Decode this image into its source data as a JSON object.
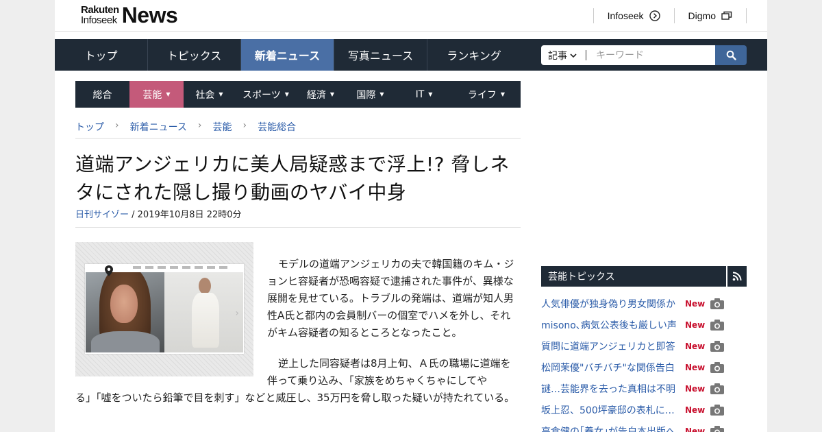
{
  "header": {
    "logo_brand": "Rakuten",
    "logo_sub": "Infoseek",
    "logo_product": "News",
    "links": [
      {
        "label": "Infoseek",
        "icon": "arrow-circle-icon"
      },
      {
        "label": "Digmo",
        "icon": "windows-icon"
      }
    ]
  },
  "main_nav": {
    "items": [
      {
        "label": "トップ",
        "active": false
      },
      {
        "label": "トピックス",
        "active": false
      },
      {
        "label": "新着ニュース",
        "active": true
      },
      {
        "label": "写真ニュース",
        "active": false
      },
      {
        "label": "ランキング",
        "active": false
      }
    ],
    "search": {
      "category": "記事",
      "placeholder": "キーワード"
    }
  },
  "category_nav": {
    "items": [
      {
        "label": "総合",
        "has_caret": false,
        "active": false
      },
      {
        "label": "芸能",
        "has_caret": true,
        "active": true
      },
      {
        "label": "社会",
        "has_caret": true,
        "active": false
      },
      {
        "label": "スポーツ",
        "has_caret": true,
        "active": false
      },
      {
        "label": "経済",
        "has_caret": true,
        "active": false
      },
      {
        "label": "国際",
        "has_caret": true,
        "active": false
      },
      {
        "label": "IT",
        "has_caret": true,
        "active": false
      },
      {
        "label": "ライフ",
        "has_caret": true,
        "active": false
      }
    ],
    "caret": "▼"
  },
  "breadcrumb": [
    "トップ",
    "新着ニュース",
    "芸能",
    "芸能総合"
  ],
  "article": {
    "title": "道端アンジェリカに美人局疑惑まで浮上!? 脅しネタにされた隠し撮り動画のヤバイ中身",
    "source": "日刊サイゾー",
    "date": " / 2019年10月8日 22時0分",
    "paragraph1": "モデルの道端アンジェリカの夫で韓国籍のキム・ジョンヒ容疑者が恐喝容疑で逮捕された事件が、異様な展開を見せている。トラブルの発端は、道端が知人男性A氏と都内の会員制バーの個室でハメを外し、それがキム容疑者の知るところとなったこと。",
    "paragraph2_start": "逆上した同容疑者は8月上旬、Ａ氏の職場に道端を伴って乗り込み、「家族をめちゃくちゃにしてや",
    "paragraph2_end": "る」「嘘をついたら鉛筆で目を刺す」などと威圧し、35万円を脅し取った疑いが持たれている。"
  },
  "sidebar": {
    "title": "芸能トピックス",
    "topics": [
      {
        "title": "人気俳優が独身偽り男女関係か",
        "badge": "New"
      },
      {
        "title": "misono､病気公表後も厳しい声",
        "badge": "New"
      },
      {
        "title": "質問に道端アンジェリカと即答",
        "badge": "New"
      },
      {
        "title": "松岡茉優\"バチバチ\"な関係告白",
        "badge": "New"
      },
      {
        "title": "謎…芸能界を去った真相は不明",
        "badge": "New"
      },
      {
        "title": "坂上忍、500坪豪邸の表札には…",
        "badge": "New"
      },
      {
        "title": "高倉健の｢養女｣が告白本出版へ",
        "badge": "New"
      }
    ]
  },
  "colors": {
    "nav_dark": "#1f2a36",
    "nav_active": "#4a6fa5",
    "category_active": "#c45a7a",
    "link": "#2a5ba8",
    "new_badge": "#c8102e"
  }
}
